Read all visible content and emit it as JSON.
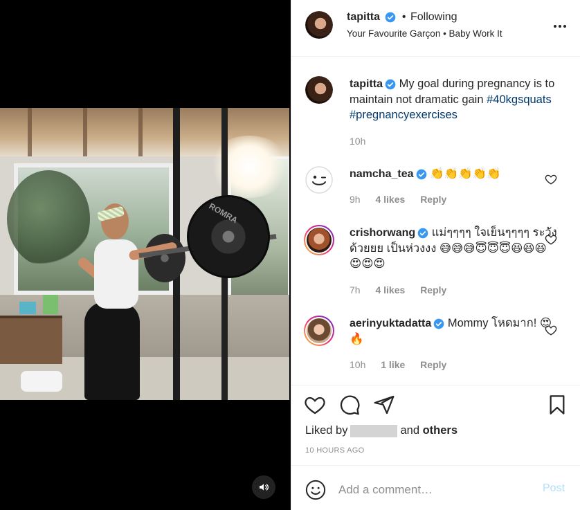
{
  "header": {
    "username": "tapitta",
    "separator": "•",
    "follow_status": "Following",
    "music": "Your Favourite Garçon • Baby Work It"
  },
  "caption": {
    "username": "tapitta",
    "text": "My goal during pregnancy is to maintain not dramatic gain",
    "hashtag1": "#40kgsquats",
    "hashtag2": "#pregnancyexercises",
    "time": "10h"
  },
  "comments": [
    {
      "username": "namcha_tea",
      "text": "👏👏👏👏👏",
      "time": "9h",
      "likes": "4 likes",
      "reply": "Reply"
    },
    {
      "username": "crishorwang",
      "text": "แม่ๆๆๆๆ ใจเย็นๆๆๆๆ ระวังด้วยยย เป็นห่วงงง 😅😅😅😇😇😇😆😆😆😍😍😍",
      "time": "7h",
      "likes": "4 likes",
      "reply": "Reply"
    },
    {
      "username": "aerinyuktadatta",
      "text": "Mommy โหดมาก! 😍🔥",
      "time": "10h",
      "likes": "1 like",
      "reply": "Reply"
    }
  ],
  "liked_by": {
    "prefix": "Liked by",
    "mid": "and",
    "others": "others"
  },
  "post_time": "10 HOURS AGO",
  "add_comment": {
    "placeholder": "Add a comment…",
    "post_label": "Post"
  },
  "media": {
    "plate_text": "ROMRA"
  },
  "icons": {
    "verified": "verified-badge-icon",
    "more": "more-options-icon",
    "heart": "heart-icon",
    "comment": "comment-icon",
    "share": "share-icon",
    "save": "bookmark-icon",
    "emoji": "emoji-icon",
    "sound": "speaker-icon"
  },
  "colors": {
    "verified_blue": "#3897f0",
    "hashtag": "#00376b",
    "muted": "#8e8e8e",
    "post_disabled": "#b2dffc"
  }
}
